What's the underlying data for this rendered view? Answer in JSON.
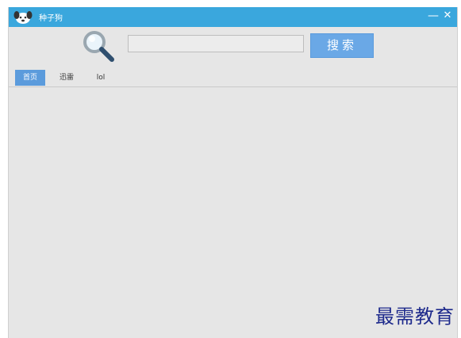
{
  "app": {
    "title": "种子狗",
    "minimize_label": "—",
    "close_label": "✕"
  },
  "search": {
    "value": "",
    "placeholder": "",
    "button_label": "搜索"
  },
  "tabs": [
    {
      "label": "首页",
      "active": true
    },
    {
      "label": "迅雷",
      "active": false
    },
    {
      "label": "lol",
      "active": false
    }
  ],
  "watermark": "最需教育",
  "colors": {
    "titlebar": "#3aa7dd",
    "accent": "#5b9bdc",
    "search_button": "#6aa8e6",
    "background": "#e6e6e6"
  },
  "icons": {
    "app_logo": "dog-icon",
    "search": "magnifier-icon"
  }
}
